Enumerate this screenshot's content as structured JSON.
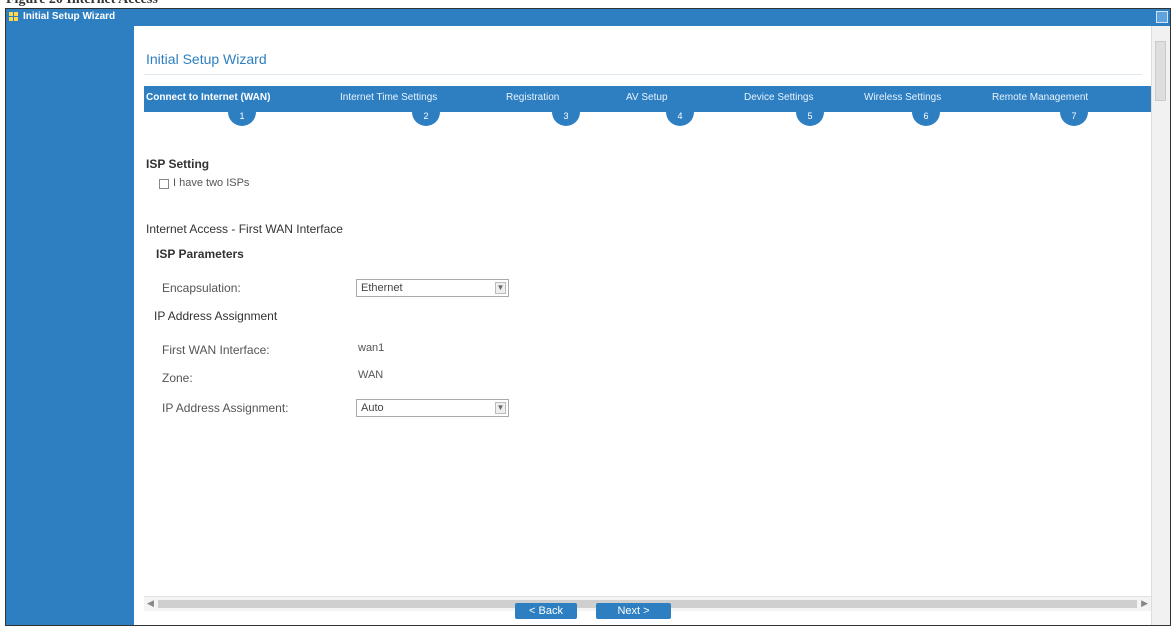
{
  "caption": "Figure 20   Internet Access",
  "window": {
    "title": "Initial Setup Wizard",
    "heading": "Initial Setup Wizard"
  },
  "steps": [
    {
      "label": "Connect to Internet (WAN)",
      "number": "1"
    },
    {
      "label": "Internet Time Settings",
      "number": "2"
    },
    {
      "label": "Registration",
      "number": "3"
    },
    {
      "label": "AV Setup",
      "number": "4"
    },
    {
      "label": "Device Settings",
      "number": "5"
    },
    {
      "label": "Wireless Settings",
      "number": "6"
    },
    {
      "label": "Remote Management",
      "number": "7"
    }
  ],
  "isp_setting": {
    "heading": "ISP Setting",
    "checkbox_label": "I have two ISPs"
  },
  "internet_access": {
    "heading": "Internet Access - First WAN Interface",
    "isp_parameters": "ISP Parameters",
    "encapsulation_label": "Encapsulation:",
    "encapsulation_value": "Ethernet",
    "ip_assignment_heading": "IP Address Assignment",
    "first_wan_label": "First WAN Interface:",
    "first_wan_value": "wan1",
    "zone_label": "Zone:",
    "zone_value": "WAN",
    "ip_assignment_label": "IP Address Assignment:",
    "ip_assignment_value": "Auto"
  },
  "buttons": {
    "back": "< Back",
    "next": "Next >"
  }
}
